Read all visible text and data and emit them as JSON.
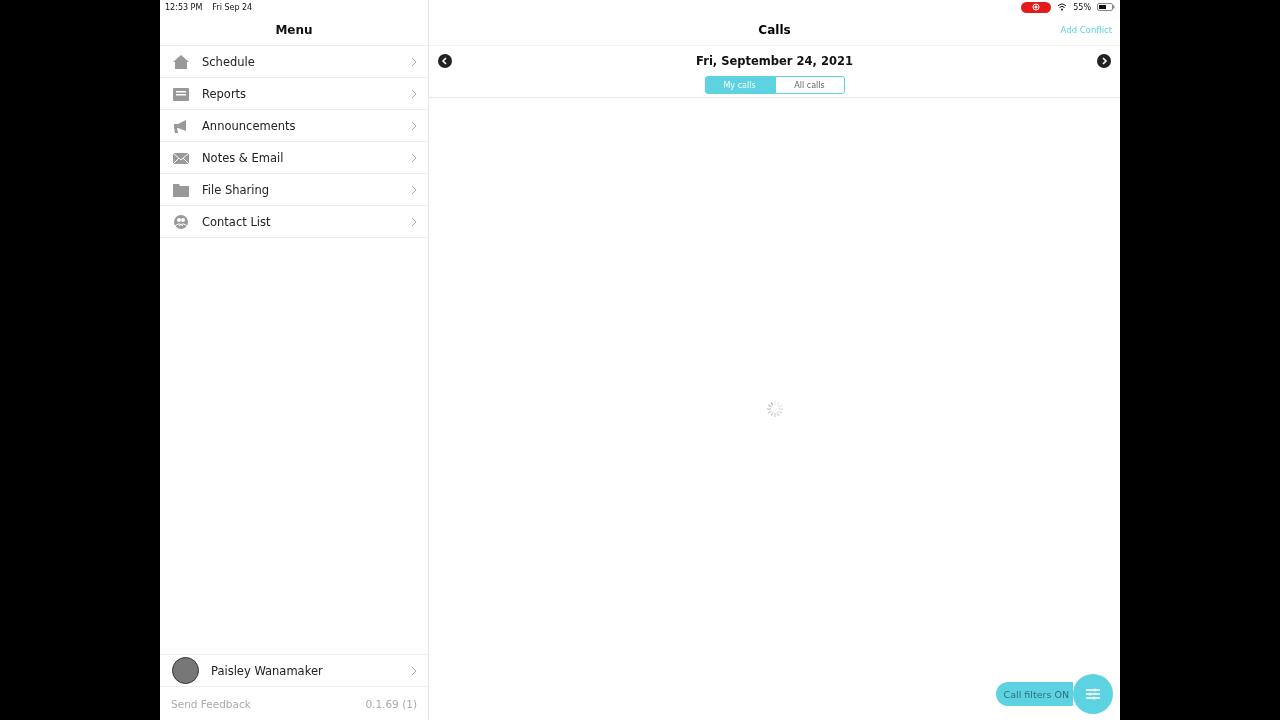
{
  "status_bar": {
    "time": "12:53 PM",
    "date": "Fri Sep 24",
    "battery_text": "55%"
  },
  "sidebar": {
    "title": "Menu",
    "items": [
      {
        "label": "Schedule",
        "kind": "home"
      },
      {
        "label": "Reports",
        "kind": "reports"
      },
      {
        "label": "Announcements",
        "kind": "megaphone"
      },
      {
        "label": "Notes & Email",
        "kind": "mail"
      },
      {
        "label": "File Sharing",
        "kind": "folder"
      },
      {
        "label": "Contact List",
        "kind": "contacts"
      }
    ],
    "user": {
      "name": "Paisley Wanamaker"
    },
    "feedback": "Send Feedback",
    "version": "0.1.69 (1)"
  },
  "main": {
    "title": "Calls",
    "action": "Add Conflict",
    "date": "Fri, September 24, 2021",
    "tabs": [
      {
        "label": "My calls",
        "selected": true
      },
      {
        "label": "All calls",
        "selected": false
      }
    ],
    "filter_button": "Call filters ON"
  }
}
